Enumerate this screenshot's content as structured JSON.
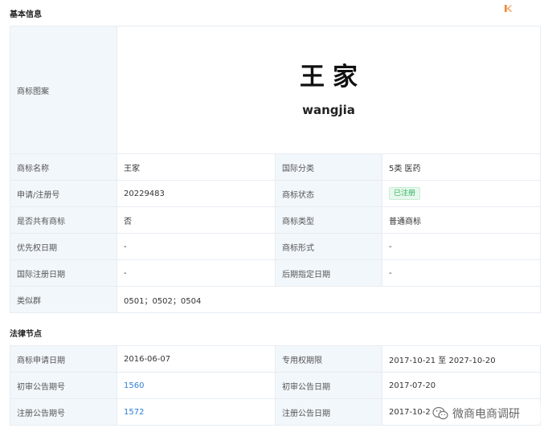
{
  "sections": {
    "basic_title": "基本信息",
    "legal_title": "法律节点"
  },
  "basic": {
    "logo_label": "商标图案",
    "logo_main": "王家",
    "logo_sub": "wangjia",
    "rows": [
      {
        "l1": "商标名称",
        "v1": "王家",
        "l2": "国际分类",
        "v2": "5类 医药"
      },
      {
        "l1": "申请/注册号",
        "v1": "20229483",
        "l2": "商标状态",
        "v2": "已注册"
      },
      {
        "l1": "是否共有商标",
        "v1": "否",
        "l2": "商标类型",
        "v2": "普通商标"
      },
      {
        "l1": "优先权日期",
        "v1": "-",
        "l2": "商标形式",
        "v2": "-"
      },
      {
        "l1": "国际注册日期",
        "v1": "-",
        "l2": "后期指定日期",
        "v2": "-"
      }
    ],
    "similar_label": "类似群",
    "similar_value": "0501；0502；0504"
  },
  "legal": {
    "rows": [
      {
        "l1": "商标申请日期",
        "v1": "2016-06-07",
        "l2": "专用权期限",
        "v2": "2017-10-21 至 2027-10-20"
      },
      {
        "l1": "初审公告期号",
        "v1": "1560",
        "l2": "初审公告日期",
        "v2": "2017-07-20"
      },
      {
        "l1": "注册公告期号",
        "v1": "1572",
        "l2": "注册公告日期",
        "v2": "2017-10-2"
      }
    ]
  },
  "watermark": {
    "text": "微商电商调研",
    "icon": "wechat-icon"
  },
  "colors": {
    "label_bg": "#f2f7fc",
    "border": "#e8ecf1",
    "link": "#2f7fd4",
    "status_green": "#2db45a",
    "corner_icon": "#f08a3c"
  },
  "icons": {
    "corner": "edit-icon"
  }
}
